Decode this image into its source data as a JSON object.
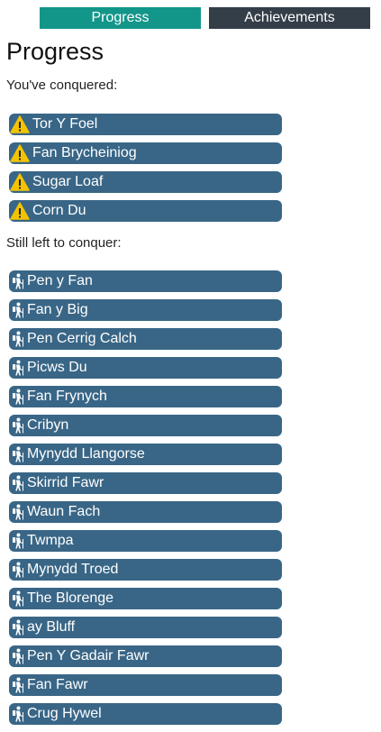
{
  "tabs": {
    "progress": "Progress",
    "achievements": "Achievements"
  },
  "page": {
    "title": "Progress",
    "conquered_label": "You've conquered:",
    "remaining_label": "Still left to conquer:"
  },
  "colors": {
    "tab_active": "#13968a",
    "tab_inactive": "#343e48",
    "item_bg": "#396686",
    "warning_icon": "#f3c300"
  },
  "conquered": [
    {
      "name": "Tor Y Foel",
      "icon": "warning-icon"
    },
    {
      "name": "Fan Brycheiniog",
      "icon": "warning-icon"
    },
    {
      "name": "Sugar Loaf",
      "icon": "warning-icon"
    },
    {
      "name": "Corn Du",
      "icon": "warning-icon"
    }
  ],
  "remaining": [
    {
      "name": "Pen y Fan",
      "icon": "hiker-icon"
    },
    {
      "name": "Fan y Big",
      "icon": "hiker-icon"
    },
    {
      "name": "Pen Cerrig Calch",
      "icon": "hiker-icon"
    },
    {
      "name": "Picws Du",
      "icon": "hiker-icon"
    },
    {
      "name": "Fan Frynych",
      "icon": "hiker-icon"
    },
    {
      "name": "Cribyn",
      "icon": "hiker-icon"
    },
    {
      "name": "Mynydd Llangorse",
      "icon": "hiker-icon"
    },
    {
      "name": "Skirrid Fawr",
      "icon": "hiker-icon"
    },
    {
      "name": "Waun Fach",
      "icon": "hiker-icon"
    },
    {
      "name": "Twmpa",
      "icon": "hiker-icon"
    },
    {
      "name": "Mynydd Troed",
      "icon": "hiker-icon"
    },
    {
      "name": "The Blorenge",
      "icon": "hiker-icon"
    },
    {
      "name": "ay Bluff",
      "icon": "hiker-icon"
    },
    {
      "name": "Pen Y Gadair Fawr",
      "icon": "hiker-icon"
    },
    {
      "name": "Fan Fawr",
      "icon": "hiker-icon"
    },
    {
      "name": "Crug Hywel",
      "icon": "hiker-icon"
    }
  ]
}
